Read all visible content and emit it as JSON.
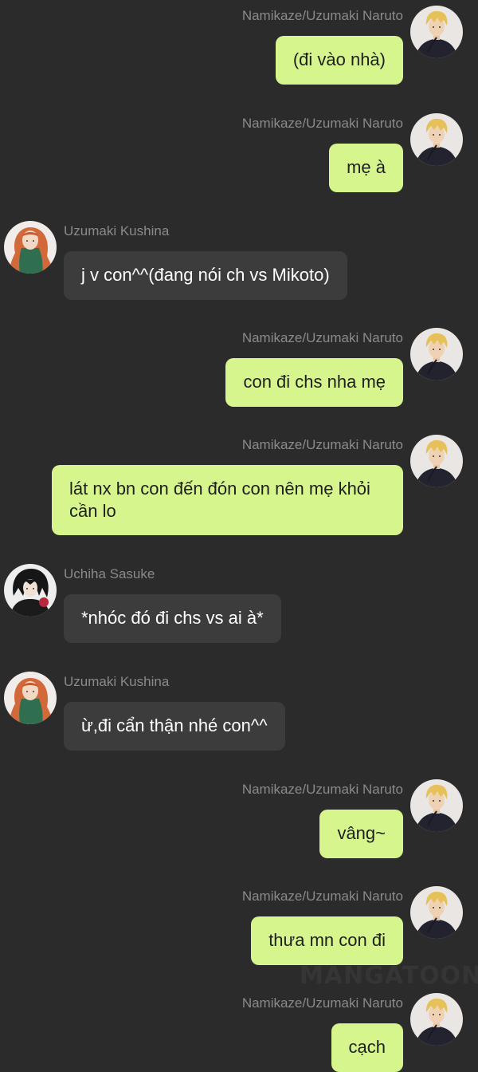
{
  "colors": {
    "background": "#2b2b2b",
    "outgoing_bubble": "#d6f58d",
    "incoming_bubble": "#3c3c3c",
    "name_text": "#8a8a8a"
  },
  "watermark": "MANGATOON",
  "messages": [
    {
      "side": "right",
      "avatar": "naruto-avatar-icon",
      "name": "Namikaze/Uzumaki Naruto",
      "text": "(đi vào nhà)"
    },
    {
      "side": "right",
      "avatar": "naruto-avatar-icon",
      "name": "Namikaze/Uzumaki Naruto",
      "text": "mẹ à"
    },
    {
      "side": "left",
      "avatar": "kushina-avatar-icon",
      "name": "Uzumaki Kushina",
      "text": "j v con^^(đang nói ch vs Mikoto)"
    },
    {
      "side": "right",
      "avatar": "naruto-avatar-icon",
      "name": "Namikaze/Uzumaki Naruto",
      "text": "con đi chs nha mẹ"
    },
    {
      "side": "right",
      "avatar": "naruto-avatar-icon",
      "name": "Namikaze/Uzumaki Naruto",
      "text": "lát nx bn con đến đón con nên mẹ khỏi cần lo"
    },
    {
      "side": "left",
      "avatar": "sasuke-avatar-icon",
      "name": "Uchiha Sasuke",
      "text": "*nhóc đó đi chs vs ai à*"
    },
    {
      "side": "left",
      "avatar": "kushina-avatar-icon",
      "name": "Uzumaki Kushina",
      "text": "ừ,đi cẩn thận nhé con^^"
    },
    {
      "side": "right",
      "avatar": "naruto-avatar-icon",
      "name": "Namikaze/Uzumaki Naruto",
      "text": "vâng~"
    },
    {
      "side": "right",
      "avatar": "naruto-avatar-icon",
      "name": "Namikaze/Uzumaki Naruto",
      "text": "thưa mn con đi"
    },
    {
      "side": "right",
      "avatar": "naruto-avatar-icon",
      "name": "Namikaze/Uzumaki Naruto",
      "text": "cạch"
    }
  ]
}
